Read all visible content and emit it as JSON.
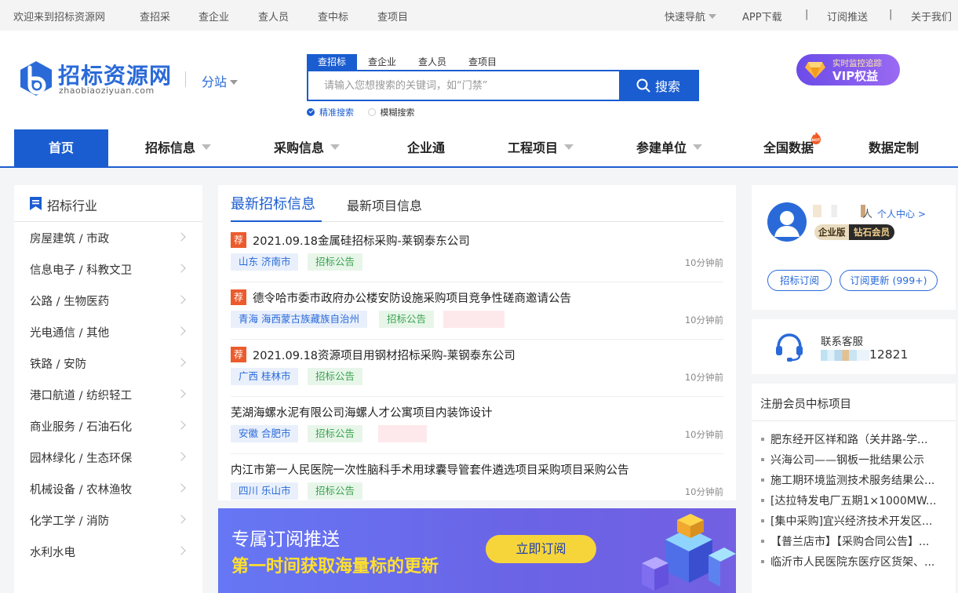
{
  "topbar": {
    "welcome": "欢迎来到招标资源网",
    "links": [
      "查招采",
      "查企业",
      "查人员",
      "查中标",
      "查项目"
    ],
    "quick_nav": "快速导航",
    "app_download": "APP下载",
    "subscribe_push": "订阅推送",
    "about": "关于我们",
    "separator": "|"
  },
  "header": {
    "logo_title": "招标资源网",
    "logo_sub": "zhaobiaoziyuan.com",
    "substation": "分站",
    "search_tabs": [
      "查招标",
      "查企业",
      "查人员",
      "查项目"
    ],
    "search_placeholder": "请输入您想搜索的关键词，如“门禁”",
    "search_button": "搜索",
    "search_modes": [
      "精准搜索",
      "模糊搜索"
    ],
    "vip_small": "实时监控追踪",
    "vip_big": "VIP权益"
  },
  "nav": {
    "items": [
      "首页",
      "招标信息",
      "采购信息",
      "企业通",
      "工程项目",
      "参建单位",
      "全国数据",
      "数据定制"
    ],
    "hot_label": "HOT"
  },
  "left": {
    "title": "招标行业",
    "items": [
      "房屋建筑 / 市政",
      "信息电子 / 科教文卫",
      "公路 / 生物医药",
      "光电通信 / 其他",
      "铁路 / 安防",
      "港口航道 / 纺织轻工",
      "商业服务 / 石油石化",
      "园林绿化 / 生态环保",
      "机械设备 / 农林渔牧",
      "化学工学 / 消防",
      "水利水电"
    ]
  },
  "center": {
    "tab_active": "最新招标信息",
    "tab_other": "最新项目信息",
    "rec_label": "荐",
    "news": [
      {
        "title": "2021.09.18金属硅招标采购-莱钢泰东公司",
        "loc": "山东 济南市",
        "kind": "招标公告",
        "time": "10分钟前"
      },
      {
        "title": "德令哈市委市政府办公楼安防设施采购项目竞争性磋商邀请公告",
        "loc": "青海 海西蒙古族藏族自治州",
        "kind": "招标公告",
        "time": "10分钟前"
      },
      {
        "title": "2021.09.18资源项目用钢材招标采购-莱钢泰东公司",
        "loc": "广西 桂林市",
        "kind": "招标公告",
        "time": "10分钟前"
      },
      {
        "title": "芜湖海螺水泥有限公司海螺人才公寓项目内装饰设计",
        "loc": "安徽 合肥市",
        "kind": "招标公告",
        "time": "10分钟前"
      },
      {
        "title": "内江市第一人民医院一次性脑科手术用球囊导管套件遴选项目采购项目采购公告",
        "loc": "四川 乐山市",
        "kind": "招标公告",
        "time": "10分钟前"
      }
    ]
  },
  "banner": {
    "line1": "专属订阅推送",
    "line2": "第一时间获取海量标的更新",
    "button": "立即订阅"
  },
  "user": {
    "name_tail": "人",
    "center_link": "个人中心 >",
    "edition": "企业版",
    "level": "钻石会员",
    "btn_subscribe": "招标订阅",
    "btn_updates": "订阅更新 (999+)"
  },
  "service": {
    "label": "联系客服",
    "number_tail": "12821"
  },
  "winners": {
    "title": "注册会员中标项目",
    "items": [
      "肥东经开区祥和路（关井路-学...",
      "兴海公司——钢板一批结果公示",
      "施工期环境监测技术服务结果公...",
      "[达拉特发电厂五期1×1000MW...",
      "[集中采购]宜兴经济技术开发区...",
      "【普兰店市】【采购合同公告】...",
      "临沂市人民医院东医疗区货架、..."
    ]
  },
  "colors": {
    "brand": "#1a5dd0",
    "rec": "#ec5b2c",
    "banner_accent": "#ffe02e"
  }
}
